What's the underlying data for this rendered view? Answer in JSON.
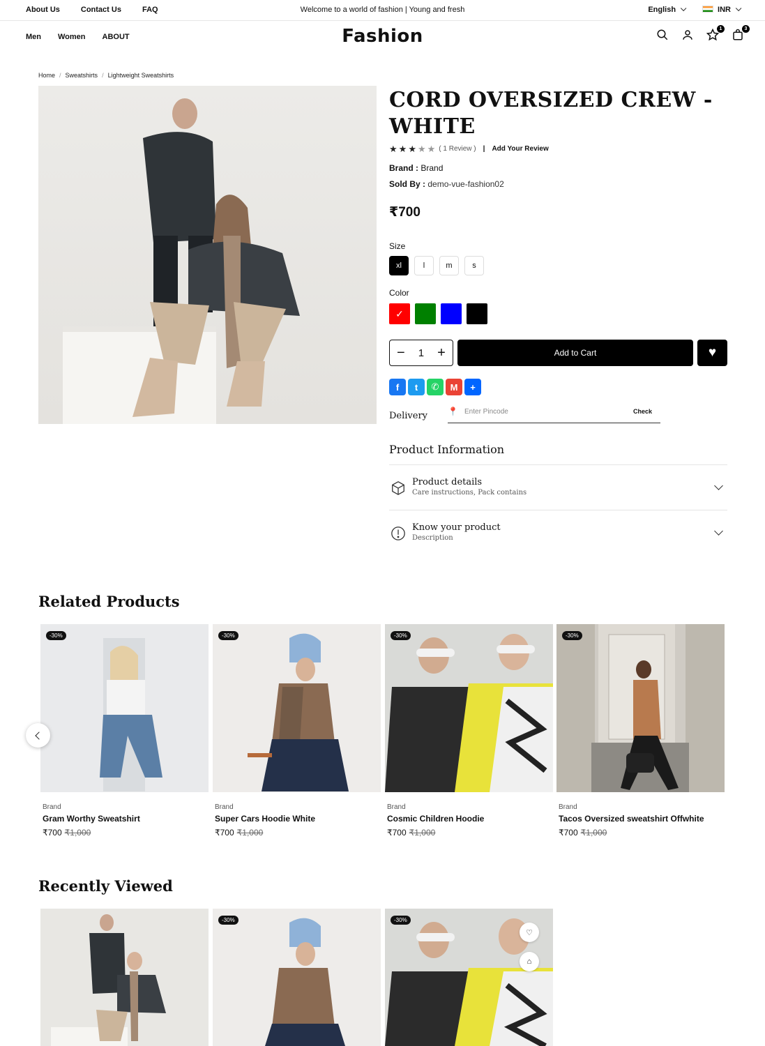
{
  "topbar": {
    "links": [
      "About Us",
      "Contact Us",
      "FAQ"
    ],
    "welcome": "Welcome to a world of fashion | Young and fresh",
    "language": "English",
    "currency": "INR"
  },
  "header": {
    "nav": [
      "Men",
      "Women",
      "ABOUT"
    ],
    "logo": "Fashion",
    "wishlist_count": "1",
    "cart_count": "3"
  },
  "breadcrumb": [
    "Home",
    "Sweatshirts",
    "Lightweight Sweatshirts"
  ],
  "product": {
    "title": "CORD OVERSIZED CREW - WHITE",
    "rating": 3,
    "rating_max": 5,
    "review_count": "( 1 Review )",
    "add_review": "Add Your Review",
    "brand_label": "Brand :",
    "brand": "Brand",
    "sold_by_label": "Sold By :",
    "sold_by": "demo-vue-fashion02",
    "price": "₹700",
    "size_label": "Size",
    "sizes": [
      "xl",
      "l",
      "m",
      "s"
    ],
    "selected_size": "xl",
    "color_label": "Color",
    "colors": [
      "#ff0000",
      "#008000",
      "#0000ff",
      "#000000"
    ],
    "quantity": "1",
    "add_to_cart": "Add to Cart",
    "delivery_label": "Delivery",
    "pincode_placeholder": "Enter Pincode",
    "check_label": "Check",
    "info_title": "Product Information",
    "accordions": [
      {
        "title": "Product details",
        "subtitle": "Care instructions, Pack contains",
        "icon": "box-icon"
      },
      {
        "title": "Know your product",
        "subtitle": "Description",
        "icon": "info-icon"
      }
    ]
  },
  "related": {
    "title": "Related Products",
    "items": [
      {
        "discount": "-30%",
        "brand": "Brand",
        "name": "Gram Worthy Sweatshirt",
        "price": "₹700",
        "old_price": "₹1,000"
      },
      {
        "discount": "-30%",
        "brand": "Brand",
        "name": "Super Cars Hoodie White",
        "price": "₹700",
        "old_price": "₹1,000"
      },
      {
        "discount": "-30%",
        "brand": "Brand",
        "name": "Cosmic Children Hoodie",
        "price": "₹700",
        "old_price": "₹1,000"
      },
      {
        "discount": "-30%",
        "brand": "Brand",
        "name": "Tacos Oversized sweatshirt Offwhite",
        "price": "₹700",
        "old_price": "₹1,000"
      }
    ]
  },
  "recent": {
    "title": "Recently Viewed",
    "items": [
      {
        "discount": ""
      },
      {
        "discount": "-30%"
      },
      {
        "discount": "-30%"
      }
    ]
  },
  "share_icons": [
    "facebook-icon",
    "twitter-icon",
    "whatsapp-icon",
    "gmail-icon",
    "share-plus-icon"
  ]
}
